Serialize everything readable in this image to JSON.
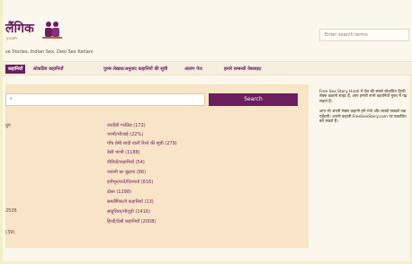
{
  "header": {
    "logo_text": "लैंगिक",
    "logo_sub": "y.com",
    "tagline": "se Stories, Indian Sex, Desi Sex Kahani",
    "search_placeholder": "Enter search terms"
  },
  "nav": {
    "items": [
      "कहानियाँ",
      "लोकप्रिय कहानियाँ",
      "पुरुष लेखक/अनुवाद कहानियों की सूची",
      "अंतरंग पेज",
      "हमारे सम्बन्धी वेबसाइट"
    ]
  },
  "main": {
    "input_value": "s",
    "search_label": "Search",
    "categories": [
      "जातीय़ी गर्लफ्रेंड (172)",
      "भाभी/भौजाई (22%)",
      "पाँच प्रेमी शादी वाली रिश्ते की सूची (279)",
      "देसी भाभी (1188)",
      "वीडियो/कहानियाँ (54)",
      "जवानी का बुढ़ापा (86)",
      "हनीमून/रातें/दिनचर्या (816)",
      "दोस्त (1298)",
      "समलैंगिक/गे कहानियाँ (13)",
      "साहूलिया/मौजूदी (1416)",
      "हिन्दी/देसी कहानियाँ (2008)"
    ],
    "left_nums": [
      "ग्रुप",
      "",
      "",
      "",
      "",
      "",
      "",
      "",
      "2526",
      "",
      "(39)"
    ]
  },
  "sidebar": {
    "para1": "Free Sex Story Hindi में देश की सबसे लोकप्रिय हिन्दी सेक्स कहानी साइट हैं, आप हमारी सभी कहानियाँ मुफ्त में पढ़ सकते हैं।",
    "para2": "आप भी अपनी सेक्स कहानी हमें भेजें और लाखों पाठकों तक पहुँचाएँ। अपनी कहानी FreeSexStory.com पर प्रकाशित कर सकते हैं।"
  },
  "colors": {
    "brand": "#6b1d5e",
    "panel": "#f8e4c6",
    "page_bg": "#fbf7ec",
    "outer_bg": "#f3f0c8"
  }
}
